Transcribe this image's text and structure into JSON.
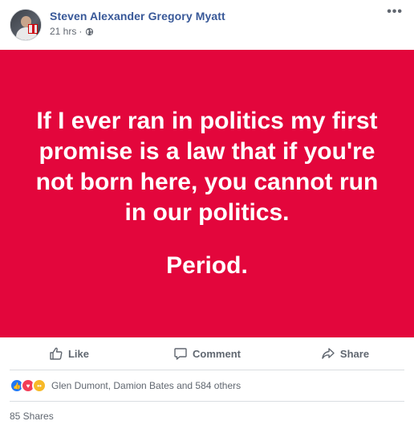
{
  "post": {
    "author": "Steven Alexander Gregory Myatt",
    "time": "21 hrs",
    "time_separator": "·",
    "more_label": "•••",
    "background_color": "#e3063c",
    "text_lines": [
      "If I ever ran in politics my first",
      "promise is a law that if you're",
      "not born here, you cannot run",
      "in our politics."
    ],
    "closing_line": "Period."
  },
  "actions": {
    "like": "Like",
    "comment": "Comment",
    "share": "Share"
  },
  "reactions": {
    "icons": [
      "like-icon",
      "love-icon",
      "haha-icon"
    ],
    "summary": "Glen Dumont, Damion Bates and 584 others"
  },
  "shares": {
    "label": "85 Shares"
  }
}
